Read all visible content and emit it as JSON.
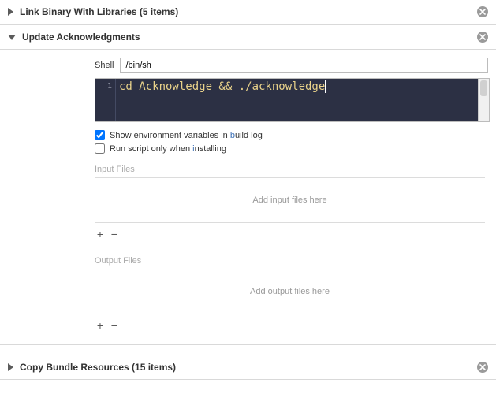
{
  "phases": {
    "link_binary": {
      "title": "Link Binary With Libraries (5 items)"
    },
    "update_ack": {
      "title": "Update Acknowledgments",
      "shell_label": "Shell",
      "shell_value": "/bin/sh",
      "line_number": "1",
      "script": "cd Acknowledge && ./acknowledge",
      "show_env_label_pre": "Show environment variables in ",
      "show_env_accent": "b",
      "show_env_label_post": "uild log",
      "show_env_checked": true,
      "run_only_label_pre": "Run script only when ",
      "run_only_accent": "i",
      "run_only_label_post": "nstalling",
      "run_only_checked": false,
      "input_files_label": "Input Files",
      "input_files_placeholder": "Add input files here",
      "output_files_label": "Output Files",
      "output_files_placeholder": "Add output files here",
      "add_glyph": "+",
      "remove_glyph": "−"
    },
    "copy_bundle": {
      "title": "Copy Bundle Resources (15 items)"
    }
  }
}
